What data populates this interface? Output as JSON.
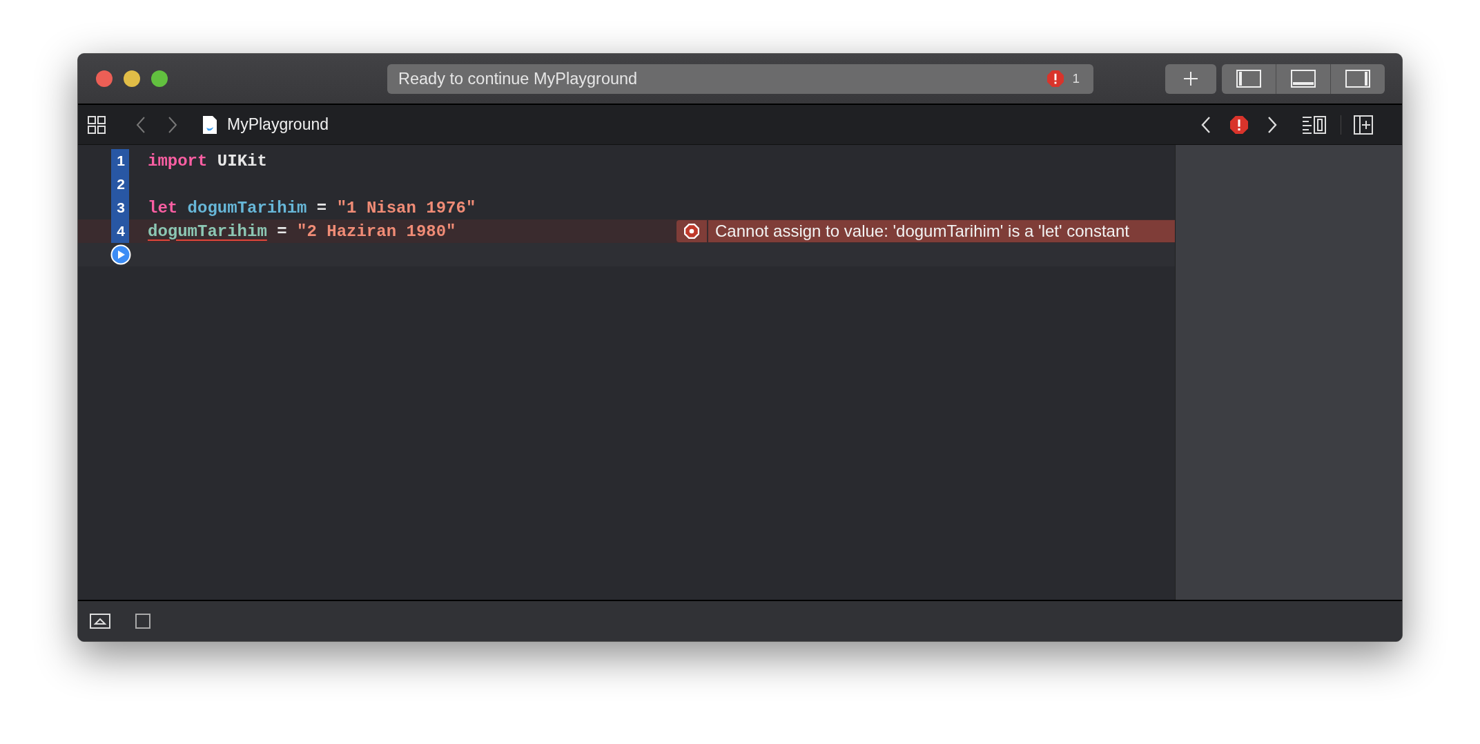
{
  "window": {
    "status": "Ready to continue MyPlayground",
    "error_count": "1"
  },
  "panel_toggles": [
    {
      "kind": "left",
      "on": true
    },
    {
      "kind": "bottom",
      "on": true
    },
    {
      "kind": "right",
      "on": true
    }
  ],
  "navigator": {
    "file_name": "MyPlayground"
  },
  "editor": {
    "lines": [
      {
        "number": "1",
        "executed": true,
        "tokens": [
          {
            "kind": "keyword",
            "text": "import"
          },
          {
            "kind": "plain",
            "text": " UIKit"
          }
        ]
      },
      {
        "number": "2",
        "executed": true
      },
      {
        "number": "3",
        "executed": true,
        "tokens": [
          {
            "kind": "keyword",
            "text": "let"
          },
          {
            "kind": "decl",
            "text": " dogumTarihim"
          },
          {
            "kind": "plain",
            "text": " = "
          },
          {
            "kind": "string",
            "text": "\"1 Nisan 1976\""
          }
        ]
      },
      {
        "number": "4",
        "executed": true,
        "error": "Cannot assign to value: 'dogumTarihim' is a 'let' constant",
        "tokens": [
          {
            "kind": "ref",
            "text": "dogumTarihim",
            "flagged": true
          },
          {
            "kind": "plain",
            "text": " = "
          },
          {
            "kind": "string",
            "text": "\"2 Haziran 1980\""
          }
        ]
      }
    ]
  }
}
